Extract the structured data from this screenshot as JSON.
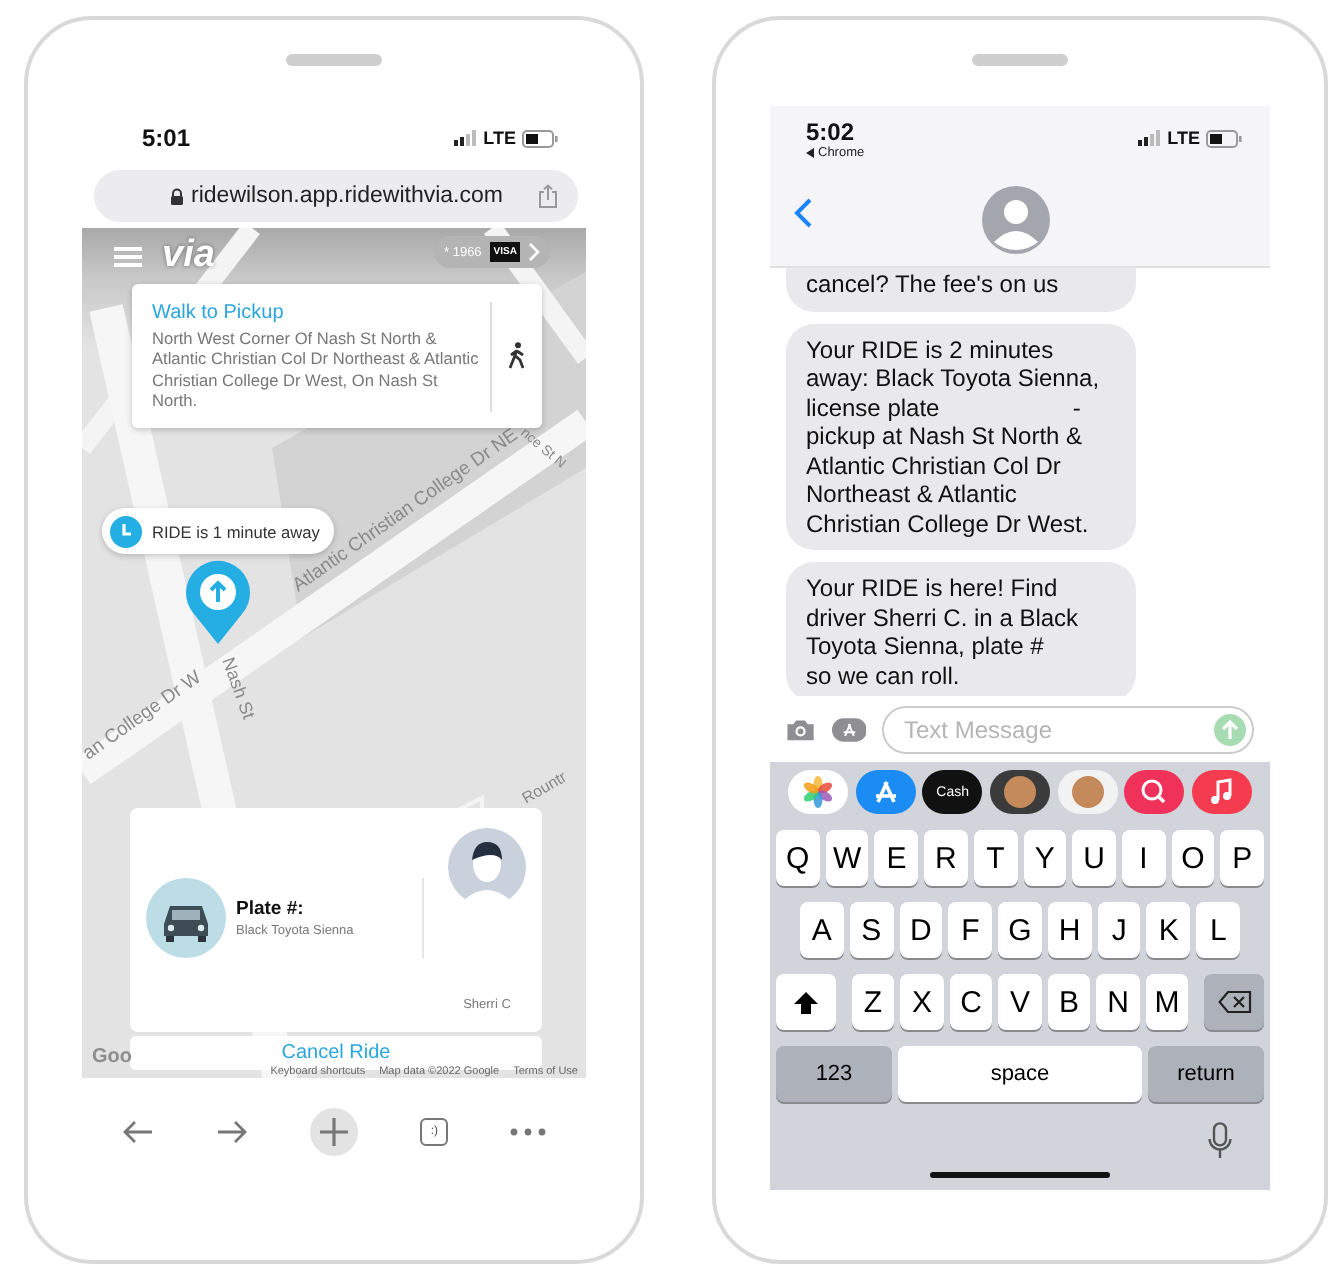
{
  "browser_phone": {
    "status_bar": {
      "time": "5:01",
      "network": "LTE"
    },
    "address_bar": {
      "url": "ridewilson.app.ridewithvia.com"
    },
    "app_header": {
      "logo": "via",
      "card_ending": "* 1966",
      "card_brand": "VISA"
    },
    "walk_card": {
      "title": "Walk to Pickup",
      "address": "North West Corner Of Nash St North & Atlantic Christian Col Dr Northeast & Atlantic Christian College Dr West, On Nash St North."
    },
    "map": {
      "street_labels": [
        "Atlantic Christian College Dr NE",
        "an College Dr W",
        "Nash St",
        "nce St N",
        "Rountr"
      ],
      "eta_bubble": "RIDE is 1 minute away",
      "google_logo": "Goo",
      "attribution": [
        "Keyboard shortcuts",
        "Map data ©2022 Google",
        "Terms of Use"
      ]
    },
    "ride_card": {
      "plate_label": "Plate #:",
      "vehicle": "Black Toyota Sienna",
      "driver": "Sherri C"
    },
    "cancel_button": "Cancel Ride",
    "toolbar": {
      "tab_count": ":)"
    }
  },
  "messages_phone": {
    "status_bar": {
      "time": "5:02",
      "back_app": "Chrome",
      "network": "LTE"
    },
    "messages": [
      {
        "text": "cancel? The fee's on us",
        "cut_top": true
      },
      {
        "text": "Your RIDE is 2 minutes away: Black Toyota Sienna,  license plate                    - pickup at Nash St North & Atlantic Christian Col Dr Northeast & Atlantic Christian College Dr West.",
        "cut_top": false
      },
      {
        "text": "Your RIDE is here! Find driver Sherri C. in a Black Toyota Sienna, plate #                    so we can roll.",
        "cut_top": false
      }
    ],
    "composer": {
      "placeholder": "Text Message"
    },
    "app_strip": [
      {
        "kind": "photos"
      },
      {
        "kind": "appstore"
      },
      {
        "kind": "cash",
        "label": "Cash"
      },
      {
        "kind": "memoji"
      },
      {
        "kind": "stickers"
      },
      {
        "kind": "search"
      },
      {
        "kind": "music"
      }
    ],
    "keyboard": {
      "rows": [
        [
          "Q",
          "W",
          "E",
          "R",
          "T",
          "Y",
          "U",
          "I",
          "O",
          "P"
        ],
        [
          "A",
          "S",
          "D",
          "F",
          "G",
          "H",
          "J",
          "K",
          "L"
        ],
        [
          "Z",
          "X",
          "C",
          "V",
          "B",
          "N",
          "M"
        ]
      ],
      "numbers_key": "123",
      "space_key": "space",
      "return_key": "return"
    }
  }
}
